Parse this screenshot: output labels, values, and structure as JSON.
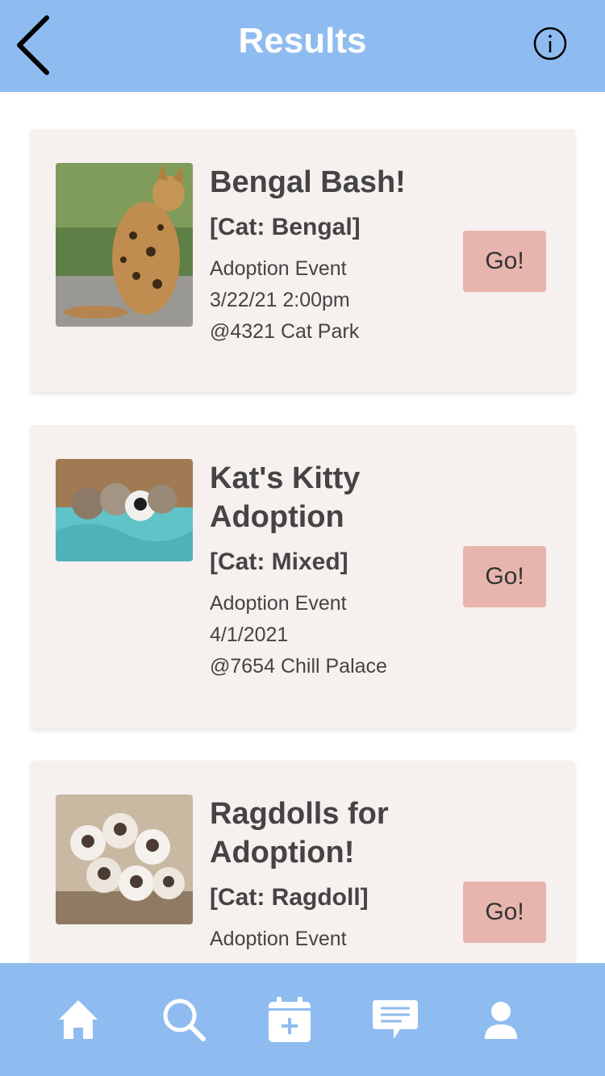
{
  "header": {
    "title": "Results",
    "back_icon": "chevron-left-icon",
    "info_icon": "info-circle-icon"
  },
  "colors": {
    "bar": "#8fbcf0",
    "card_background": "#f6f0ee",
    "go_button": "#e8b5ae",
    "text": "#444444"
  },
  "results": [
    {
      "title": "Bengal Bash!",
      "breed": "[Cat: Bengal]",
      "type": "Adoption Event",
      "date": "3/22/21 2:00pm",
      "location": "@4321 Cat Park",
      "button": "Go!",
      "image_icon": "bengal-cat-photo"
    },
    {
      "title": "Kat's Kitty Adoption",
      "breed": "[Cat: Mixed]",
      "type": "Adoption Event",
      "date": "4/1/2021",
      "location": "@7654 Chill Palace",
      "button": "Go!",
      "image_icon": "kittens-photo"
    },
    {
      "title": "Ragdolls for Adoption!",
      "breed": "[Cat: Ragdoll]",
      "type": "Adoption Event",
      "button": "Go!",
      "image_icon": "ragdoll-kittens-photo"
    }
  ],
  "tabbar": {
    "items": [
      {
        "icon": "home-icon"
      },
      {
        "icon": "search-icon"
      },
      {
        "icon": "calendar-add-icon"
      },
      {
        "icon": "chat-icon"
      },
      {
        "icon": "user-icon"
      }
    ]
  }
}
